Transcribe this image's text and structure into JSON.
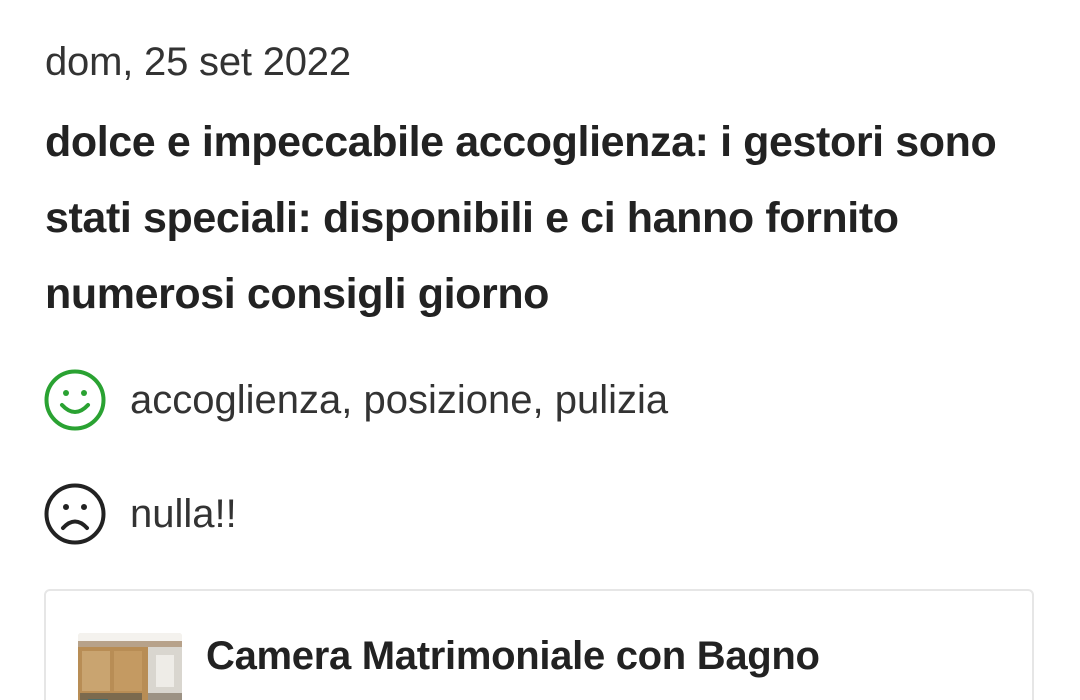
{
  "review": {
    "date": "dom, 25 set 2022",
    "title": "dolce e impeccabile accoglienza: i gestori sono stati speciali: disponibili e ci hanno fornito numerosi consigli giorno",
    "positive": {
      "icon": "smiley-face-icon",
      "color": "#2aa232",
      "text": "accoglienza, posizione, pulizia"
    },
    "negative": {
      "icon": "sad-face-icon",
      "color": "#222222",
      "text": "nulla!!"
    }
  },
  "room_card": {
    "thumbnail_icon": "room-photo",
    "name": "Camera Matrimoniale con Bagno"
  }
}
